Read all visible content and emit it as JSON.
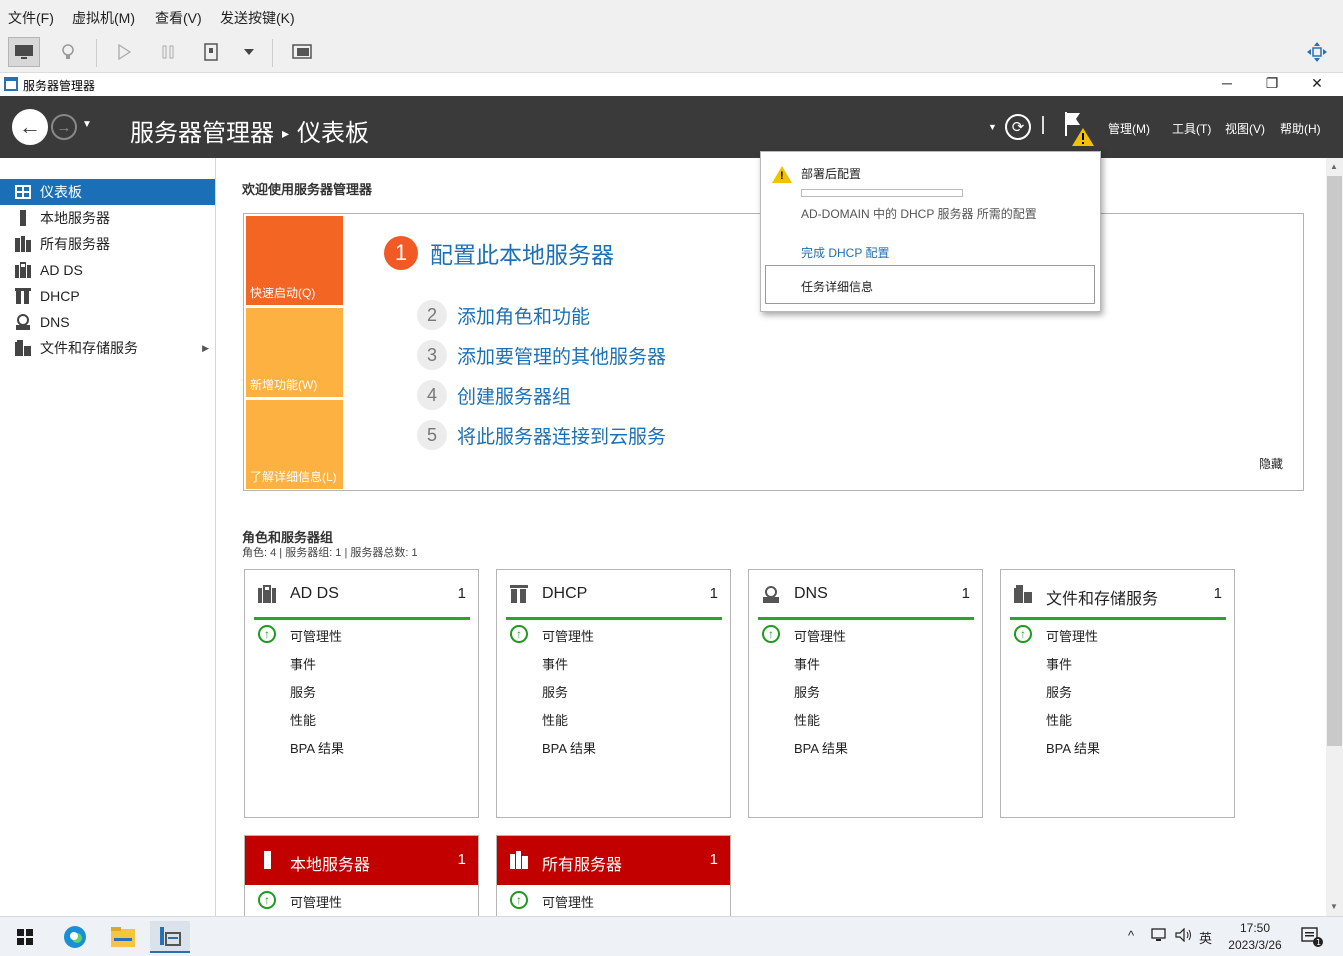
{
  "vm_menu": [
    "文件(F)",
    "虚拟机(M)",
    "查看(V)",
    "发送按键(K)"
  ],
  "app_title": "服务器管理器",
  "header": {
    "crumb_root": "服务器管理器",
    "crumb_sep": "▸",
    "crumb_page": "仪表板",
    "menus": [
      "管理(M)",
      "工具(T)",
      "视图(V)",
      "帮助(H)"
    ]
  },
  "sidebar": {
    "items": [
      {
        "label": "仪表板",
        "icon": "dashboard-icon"
      },
      {
        "label": "本地服务器",
        "icon": "server-icon"
      },
      {
        "label": "所有服务器",
        "icon": "servers-icon"
      },
      {
        "label": "AD DS",
        "icon": "ad-ds-icon"
      },
      {
        "label": "DHCP",
        "icon": "dhcp-icon"
      },
      {
        "label": "DNS",
        "icon": "dns-icon"
      },
      {
        "label": "文件和存储服务",
        "icon": "file-storage-icon"
      }
    ]
  },
  "welcome": {
    "title": "欢迎使用服务器管理器",
    "tiles": [
      "快速启动(Q)",
      "新增功能(W)",
      "了解详细信息(L)"
    ],
    "steps": [
      {
        "num": "1",
        "text": "配置此本地服务器"
      },
      {
        "num": "2",
        "text": "添加角色和功能"
      },
      {
        "num": "3",
        "text": "添加要管理的其他服务器"
      },
      {
        "num": "4",
        "text": "创建服务器组"
      },
      {
        "num": "5",
        "text": "将此服务器连接到云服务"
      }
    ],
    "hide": "隐藏"
  },
  "roles": {
    "title": "角色和服务器组",
    "subtitle": "角色: 4 | 服务器组: 1 | 服务器总数: 1",
    "row_labels": [
      "可管理性",
      "事件",
      "服务",
      "性能",
      "BPA 结果"
    ],
    "cards": [
      {
        "name": "AD DS",
        "count": "1",
        "icon": "ad-ds-icon"
      },
      {
        "name": "DHCP",
        "count": "1",
        "icon": "dhcp-icon"
      },
      {
        "name": "DNS",
        "count": "1",
        "icon": "dns-icon"
      },
      {
        "name": "文件和存储服务",
        "count": "1",
        "icon": "file-storage-icon"
      }
    ],
    "red_cards": [
      {
        "name": "本地服务器",
        "count": "1",
        "icon": "server-icon"
      },
      {
        "name": "所有服务器",
        "count": "1",
        "icon": "servers-icon"
      }
    ]
  },
  "notification": {
    "title": "部署后配置",
    "progress": 0.0,
    "description": "AD-DOMAIN 中的 DHCP 服务器 所需的配置",
    "link": "完成 DHCP 配置",
    "details": "任务详细信息"
  },
  "taskbar": {
    "tray_caret": "^",
    "ime": "英",
    "time": "17:50",
    "date": "2023/3/26",
    "notif_count": "1"
  },
  "colors": {
    "accent": "#1c70b5",
    "header_bg": "#3a3a3a",
    "quick_start": "#f26522",
    "tile_yellow": "#fdb140",
    "status_ok": "#2aa52a",
    "status_alert": "#c20000"
  }
}
